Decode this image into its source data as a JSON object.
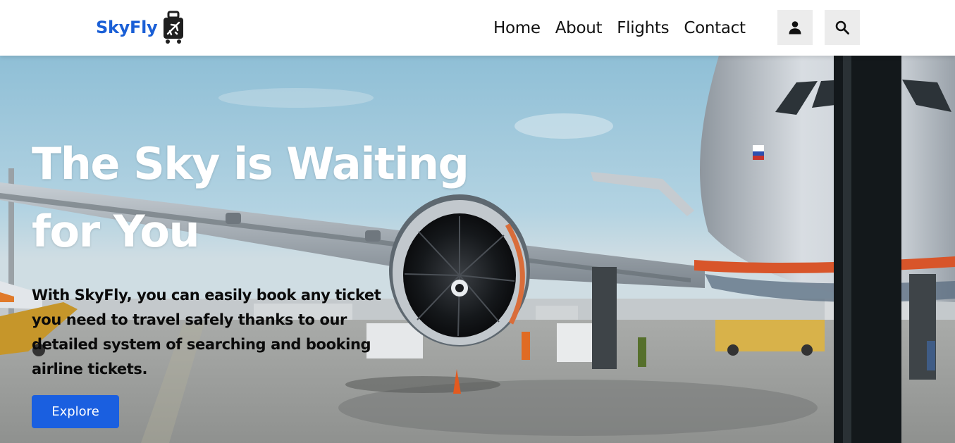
{
  "brand": {
    "name": "SkyFly",
    "icon": "luggage-plane-icon",
    "color": "#1a5fd6"
  },
  "nav": {
    "links": [
      {
        "label": "Home"
      },
      {
        "label": "About"
      },
      {
        "label": "Flights"
      },
      {
        "label": "Contact"
      }
    ],
    "user_icon": "user-icon",
    "search_icon": "search-icon"
  },
  "hero": {
    "title_line1": "The Sky is Waiting",
    "title_line2": "for You",
    "subtitle": "With SkyFly, you can easily book any ticket you need to travel safely thanks to our detailed system of searching and booking airline tickets.",
    "cta_label": "Explore",
    "background": "airplane-at-airport-photo"
  },
  "colors": {
    "accent": "#1a5fe0",
    "icon_button_bg": "#ececec",
    "text_dark": "#111111"
  }
}
